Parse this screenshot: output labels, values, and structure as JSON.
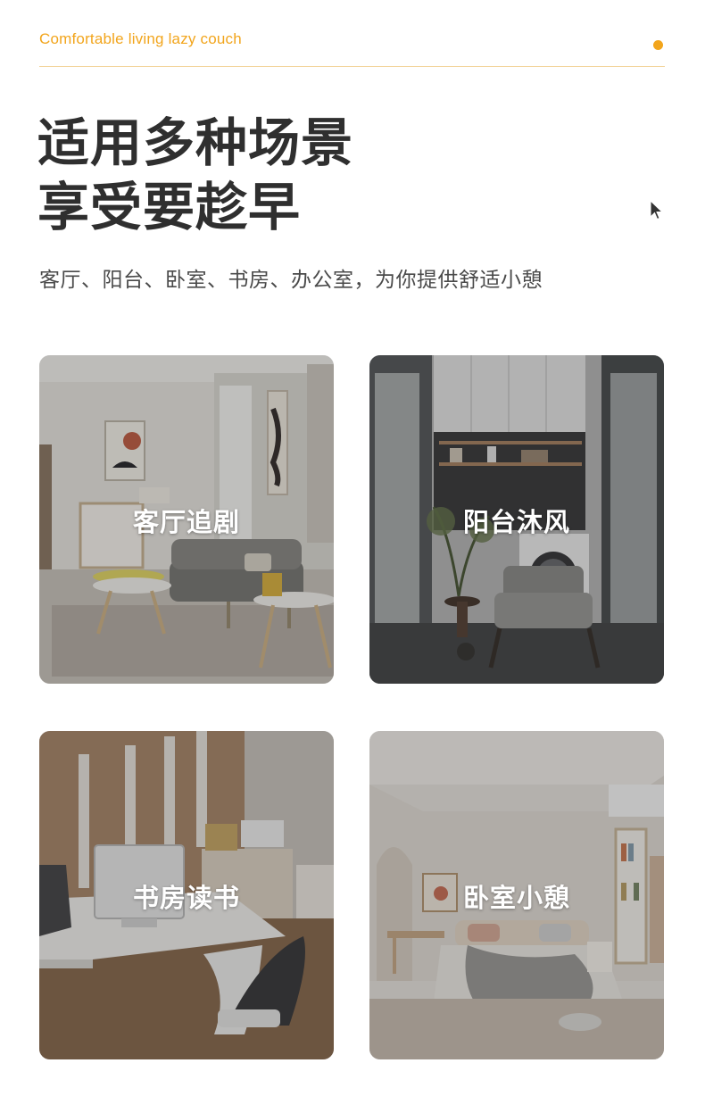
{
  "header": {
    "tagline": "Comfortable living lazy couch",
    "accent_color": "#f2a51c"
  },
  "headline": {
    "line1": "适用多种场景",
    "line2": "享受要趁早"
  },
  "subtitle": "客厅、阳台、卧室、书房、办公室，为你提供舒适小憩",
  "scenes": [
    {
      "label": "客厅追剧",
      "icon": "living-room-photo"
    },
    {
      "label": "阳台沐风",
      "icon": "balcony-photo"
    },
    {
      "label": "书房读书",
      "icon": "study-room-photo"
    },
    {
      "label": "卧室小憩",
      "icon": "bedroom-photo"
    }
  ]
}
